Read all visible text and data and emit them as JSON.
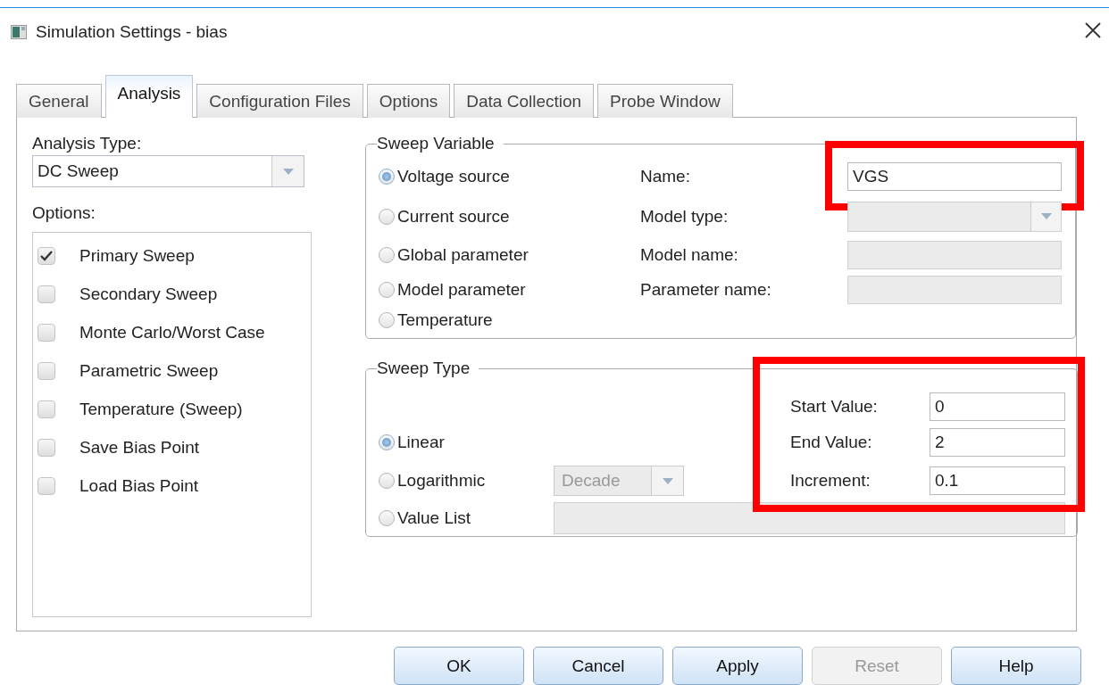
{
  "window": {
    "title": "Simulation Settings - bias"
  },
  "tabs": [
    {
      "label": "General",
      "selected": false
    },
    {
      "label": "Analysis",
      "selected": true
    },
    {
      "label": "Configuration Files",
      "selected": false
    },
    {
      "label": "Options",
      "selected": false
    },
    {
      "label": "Data Collection",
      "selected": false
    },
    {
      "label": "Probe Window",
      "selected": false
    }
  ],
  "analysis_type": {
    "label": "Analysis Type:",
    "value": "DC Sweep"
  },
  "options": {
    "label": "Options:",
    "items": [
      {
        "label": "Primary Sweep",
        "checked": true
      },
      {
        "label": "Secondary Sweep",
        "checked": false
      },
      {
        "label": "Monte Carlo/Worst Case",
        "checked": false
      },
      {
        "label": "Parametric Sweep",
        "checked": false
      },
      {
        "label": "Temperature (Sweep)",
        "checked": false
      },
      {
        "label": "Save Bias Point",
        "checked": false
      },
      {
        "label": "Load Bias Point",
        "checked": false
      }
    ]
  },
  "sweep_variable": {
    "title": "Sweep Variable",
    "choices": [
      {
        "label": "Voltage source",
        "selected": true
      },
      {
        "label": "Current source",
        "selected": false
      },
      {
        "label": "Global parameter",
        "selected": false
      },
      {
        "label": "Model parameter",
        "selected": false
      },
      {
        "label": "Temperature",
        "selected": false
      }
    ],
    "fields": [
      {
        "kind": "text",
        "label": "Name:",
        "value": "VGS",
        "disabled": false,
        "highlighted": true
      },
      {
        "kind": "dropdown",
        "label": "Model type:",
        "disabled": true,
        "highlighted": false
      },
      {
        "kind": "text",
        "label": "Model name:",
        "disabled": true,
        "highlighted": false
      },
      {
        "kind": "text",
        "label": "Parameter name:",
        "disabled": true,
        "highlighted": false
      }
    ]
  },
  "sweep_type": {
    "title": "Sweep Type",
    "choices": [
      {
        "label": "Linear",
        "selected": true
      },
      {
        "label": "Logarithmic",
        "selected": false
      },
      {
        "label": "Value List",
        "selected": false
      }
    ],
    "log_scale": {
      "value": "Decade",
      "disabled": true
    },
    "value_list": {
      "disabled": true
    },
    "range": {
      "highlighted": true,
      "fields": [
        {
          "label": "Start Value:",
          "value": "0"
        },
        {
          "label": "End Value:",
          "value": "2"
        },
        {
          "label": "Increment:",
          "value": "0.1"
        }
      ]
    }
  },
  "buttons": [
    {
      "label": "OK",
      "disabled": false
    },
    {
      "label": "Cancel",
      "disabled": false
    },
    {
      "label": "Apply",
      "disabled": false
    },
    {
      "label": "Reset",
      "disabled": true
    },
    {
      "label": "Help",
      "disabled": false
    }
  ]
}
